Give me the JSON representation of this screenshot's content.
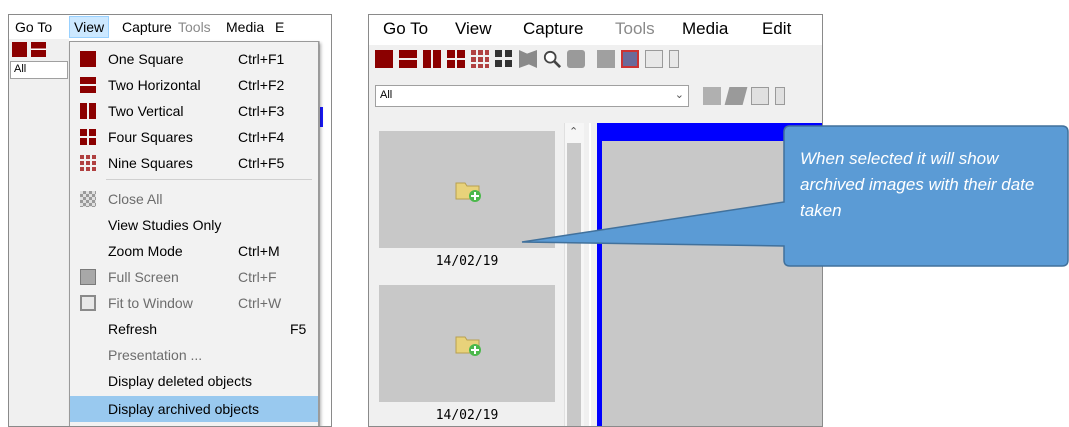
{
  "left_panel": {
    "menubar": [
      "Go To",
      "View",
      "Capture",
      "Tools",
      "Media",
      "E"
    ],
    "combo_value": "All"
  },
  "view_menu": {
    "items": [
      {
        "label": "One Square",
        "shortcut": "Ctrl+F1"
      },
      {
        "label": "Two Horizontal",
        "shortcut": "Ctrl+F2"
      },
      {
        "label": "Two Vertical",
        "shortcut": "Ctrl+F3"
      },
      {
        "label": "Four Squares",
        "shortcut": "Ctrl+F4"
      },
      {
        "label": "Nine Squares",
        "shortcut": "Ctrl+F5"
      },
      {
        "label": "Close All",
        "shortcut": ""
      },
      {
        "label": "View Studies Only",
        "shortcut": ""
      },
      {
        "label": "Zoom Mode",
        "shortcut": "Ctrl+M"
      },
      {
        "label": "Full Screen",
        "shortcut": "Ctrl+F"
      },
      {
        "label": "Fit to Window",
        "shortcut": "Ctrl+W"
      },
      {
        "label": "Refresh",
        "shortcut": "F5"
      },
      {
        "label": "Presentation ...",
        "shortcut": ""
      },
      {
        "label": "Display deleted objects",
        "shortcut": ""
      },
      {
        "label": "Display archived objects",
        "shortcut": ""
      }
    ]
  },
  "right_panel": {
    "menubar": [
      "Go To",
      "View",
      "Capture",
      "Tools",
      "Media",
      "Edit"
    ],
    "combo_value": "All",
    "thumbnails": [
      {
        "date": "14/02/19"
      },
      {
        "date": "14/02/19"
      }
    ]
  },
  "callout": {
    "text": "When selected it will show archived images with their date taken"
  },
  "colors": {
    "brand_dark_red": "#8b0000",
    "menu_highlight": "#99c9ef",
    "callout_fill": "#5b9bd5",
    "viewer_border": "#0000ff"
  }
}
